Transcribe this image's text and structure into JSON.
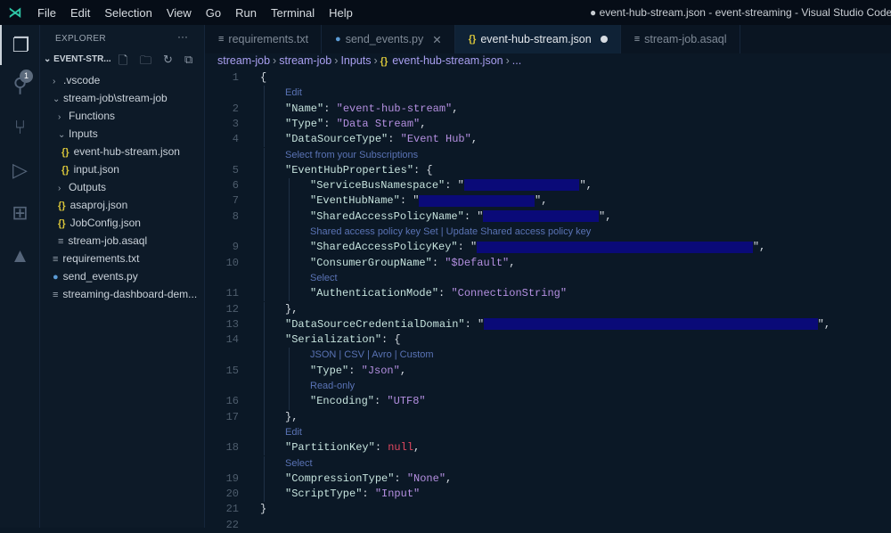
{
  "titlebar": {
    "menu": [
      "File",
      "Edit",
      "Selection",
      "View",
      "Go",
      "Run",
      "Terminal",
      "Help"
    ],
    "title": "● event-hub-stream.json - event-streaming - Visual Studio Code - Insi"
  },
  "activity": {
    "badge": "1"
  },
  "explorer": {
    "header": "EXPLORER",
    "more": "···",
    "folder": "EVENT-STR...",
    "items": [
      {
        "label": ".vscode",
        "depth": 1,
        "chev": "›",
        "icon": ""
      },
      {
        "label": "stream-job\\stream-job",
        "depth": 1,
        "chev": "⌄",
        "icon": ""
      },
      {
        "label": "Functions",
        "depth": 2,
        "chev": "›",
        "icon": ""
      },
      {
        "label": "Inputs",
        "depth": 2,
        "chev": "⌄",
        "icon": ""
      },
      {
        "label": "event-hub-stream.json",
        "depth": 3,
        "chev": "",
        "icon": "json"
      },
      {
        "label": "input.json",
        "depth": 3,
        "chev": "",
        "icon": "json"
      },
      {
        "label": "Outputs",
        "depth": 2,
        "chev": "›",
        "icon": ""
      },
      {
        "label": "asaproj.json",
        "depth": 2,
        "chev": "",
        "icon": "json"
      },
      {
        "label": "JobConfig.json",
        "depth": 2,
        "chev": "",
        "icon": "json"
      },
      {
        "label": "stream-job.asaql",
        "depth": 2,
        "chev": "",
        "icon": "txt"
      },
      {
        "label": "requirements.txt",
        "depth": 1,
        "chev": "",
        "icon": "txt"
      },
      {
        "label": "send_events.py",
        "depth": 1,
        "chev": "",
        "icon": "py"
      },
      {
        "label": "streaming-dashboard-dem...",
        "depth": 1,
        "chev": "",
        "icon": "txt"
      }
    ]
  },
  "tabs": [
    {
      "label": "requirements.txt",
      "icon": "txt",
      "active": false
    },
    {
      "label": "send_events.py",
      "icon": "py",
      "active": false,
      "close": "✕"
    },
    {
      "label": "event-hub-stream.json",
      "icon": "json",
      "active": true,
      "dirty": true
    },
    {
      "label": "stream-job.asaql",
      "icon": "txt",
      "active": false
    }
  ],
  "breadcrumb": [
    "stream-job",
    "stream-job",
    "Inputs",
    "event-hub-stream.json",
    "..."
  ],
  "code": [
    {
      "ln": "1",
      "indent": 0,
      "parts": [
        [
          "p",
          "{"
        ]
      ]
    },
    {
      "lens": "Edit",
      "indent": 1
    },
    {
      "ln": "2",
      "indent": 1,
      "parts": [
        [
          "k",
          "\"Name\""
        ],
        [
          "p",
          ": "
        ],
        [
          "s",
          "\"event-hub-stream\""
        ],
        [
          "p",
          ","
        ]
      ]
    },
    {
      "ln": "3",
      "indent": 1,
      "parts": [
        [
          "k",
          "\"Type\""
        ],
        [
          "p",
          ": "
        ],
        [
          "s",
          "\"Data Stream\""
        ],
        [
          "p",
          ","
        ]
      ]
    },
    {
      "ln": "4",
      "indent": 1,
      "parts": [
        [
          "k",
          "\"DataSourceType\""
        ],
        [
          "p",
          ": "
        ],
        [
          "s",
          "\"Event Hub\""
        ],
        [
          "p",
          ","
        ]
      ]
    },
    {
      "lens": "Select from your Subscriptions",
      "indent": 1
    },
    {
      "ln": "5",
      "indent": 1,
      "parts": [
        [
          "k",
          "\"EventHubProperties\""
        ],
        [
          "p",
          ": {"
        ]
      ]
    },
    {
      "ln": "6",
      "indent": 2,
      "parts": [
        [
          "k",
          "\"ServiceBusNamespace\""
        ],
        [
          "p",
          ": \""
        ],
        [
          "red",
          "18"
        ],
        [
          "p",
          "\","
        ]
      ]
    },
    {
      "ln": "7",
      "indent": 2,
      "parts": [
        [
          "k",
          "\"EventHubName\""
        ],
        [
          "p",
          ": \""
        ],
        [
          "red",
          "18"
        ],
        [
          "p",
          "\","
        ]
      ]
    },
    {
      "ln": "8",
      "indent": 2,
      "parts": [
        [
          "k",
          "\"SharedAccessPolicyName\""
        ],
        [
          "p",
          ": \""
        ],
        [
          "red",
          "18"
        ],
        [
          "p",
          "\","
        ]
      ]
    },
    {
      "lens": "Shared access policy key Set | Update Shared access policy key",
      "indent": 2
    },
    {
      "ln": "9",
      "indent": 2,
      "parts": [
        [
          "k",
          "\"SharedAccessPolicyKey\""
        ],
        [
          "p",
          ": \""
        ],
        [
          "red",
          "43"
        ],
        [
          "p",
          "\","
        ]
      ]
    },
    {
      "ln": "10",
      "indent": 2,
      "parts": [
        [
          "k",
          "\"ConsumerGroupName\""
        ],
        [
          "p",
          ": "
        ],
        [
          "s",
          "\"$Default\""
        ],
        [
          "p",
          ","
        ]
      ]
    },
    {
      "lens": "Select",
      "indent": 2
    },
    {
      "ln": "11",
      "indent": 2,
      "parts": [
        [
          "k",
          "\"AuthenticationMode\""
        ],
        [
          "p",
          ": "
        ],
        [
          "s",
          "\"ConnectionString\""
        ]
      ]
    },
    {
      "ln": "12",
      "indent": 1,
      "parts": [
        [
          "p",
          "},"
        ]
      ]
    },
    {
      "ln": "13",
      "indent": 1,
      "parts": [
        [
          "k",
          "\"DataSourceCredentialDomain\""
        ],
        [
          "p",
          ": \""
        ],
        [
          "red",
          "52"
        ],
        [
          "p",
          "\","
        ]
      ]
    },
    {
      "ln": "14",
      "indent": 1,
      "parts": [
        [
          "k",
          "\"Serialization\""
        ],
        [
          "p",
          ": {"
        ]
      ]
    },
    {
      "lens": "JSON | CSV | Avro | Custom",
      "indent": 2
    },
    {
      "ln": "15",
      "indent": 2,
      "parts": [
        [
          "k",
          "\"Type\""
        ],
        [
          "p",
          ": "
        ],
        [
          "s",
          "\"Json\""
        ],
        [
          "p",
          ","
        ]
      ]
    },
    {
      "lens": "Read-only",
      "indent": 2
    },
    {
      "ln": "16",
      "indent": 2,
      "parts": [
        [
          "k",
          "\"Encoding\""
        ],
        [
          "p",
          ": "
        ],
        [
          "s",
          "\"UTF8\""
        ]
      ]
    },
    {
      "ln": "17",
      "indent": 1,
      "parts": [
        [
          "p",
          "},"
        ]
      ]
    },
    {
      "lens": "Edit",
      "indent": 1
    },
    {
      "ln": "18",
      "indent": 1,
      "parts": [
        [
          "k",
          "\"PartitionKey\""
        ],
        [
          "p",
          ": "
        ],
        [
          "n",
          "null"
        ],
        [
          "p",
          ","
        ]
      ]
    },
    {
      "lens": "Select",
      "indent": 1
    },
    {
      "ln": "19",
      "indent": 1,
      "parts": [
        [
          "k",
          "\"CompressionType\""
        ],
        [
          "p",
          ": "
        ],
        [
          "s",
          "\"None\""
        ],
        [
          "p",
          ","
        ]
      ]
    },
    {
      "ln": "20",
      "indent": 1,
      "parts": [
        [
          "k",
          "\"ScriptType\""
        ],
        [
          "p",
          ": "
        ],
        [
          "s",
          "\"Input\""
        ]
      ]
    },
    {
      "ln": "21",
      "indent": 0,
      "parts": [
        [
          "p",
          "}"
        ]
      ]
    },
    {
      "ln": "22",
      "indent": 0,
      "parts": []
    }
  ]
}
